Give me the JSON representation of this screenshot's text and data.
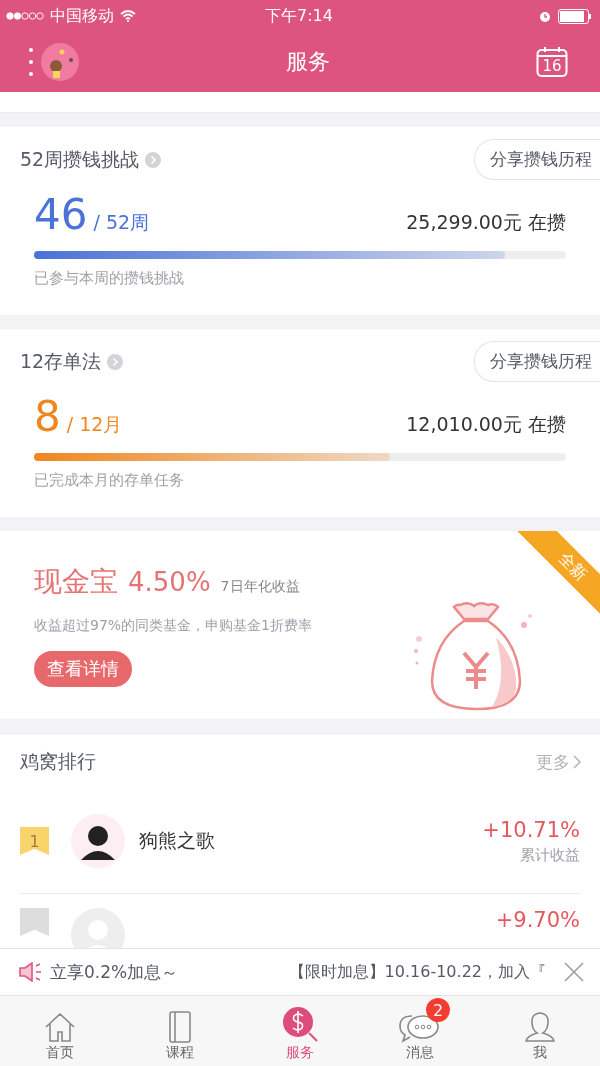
{
  "status_bar": {
    "carrier": "中国移动",
    "time": "下午7:14"
  },
  "nav": {
    "title": "服务",
    "calendar_day": "16"
  },
  "challenges": [
    {
      "title": "52周攒钱挑战",
      "share_button": "分享攒钱历程",
      "count": "46",
      "total": "/ 52周",
      "amount": "25,299.00元 在攒",
      "caption": "已参与本周的攒钱挑战",
      "level": 0.885,
      "color": "#4a72d8"
    },
    {
      "title": "12存单法",
      "share_button": "分享攒钱历程",
      "count": "8",
      "total": "/ 12月",
      "amount": "12,010.00元 在攒",
      "caption": "已完成本月的存单任务",
      "level": 0.67,
      "color": "#f0861e"
    }
  ],
  "promo": {
    "badge": "全新",
    "name": "现金宝",
    "rate": "4.50%",
    "rate_label": "7日年化收益",
    "description": "收益超过97%的同类基金，申购基金1折费率",
    "button": "查看详情"
  },
  "ranking": {
    "title": "鸡窝排行",
    "more": "更多",
    "rows": [
      {
        "rank": "1",
        "color": "#f9d46a",
        "name": "狗熊之歌",
        "value": "+10.71%",
        "value_label": "累计收益"
      },
      {
        "color": "#dddddd",
        "value": "+9.70%"
      }
    ]
  },
  "notice": {
    "title": "立享0.2%加息～",
    "message": "【限时加息】10.16-10.22，加入『"
  },
  "tabs": [
    {
      "label": "首页",
      "selected": false
    },
    {
      "label": "课程",
      "selected": false
    },
    {
      "label": "服务",
      "selected": true
    },
    {
      "label": "消息",
      "selected": false,
      "badge": "2"
    },
    {
      "label": "我",
      "selected": false
    }
  ]
}
